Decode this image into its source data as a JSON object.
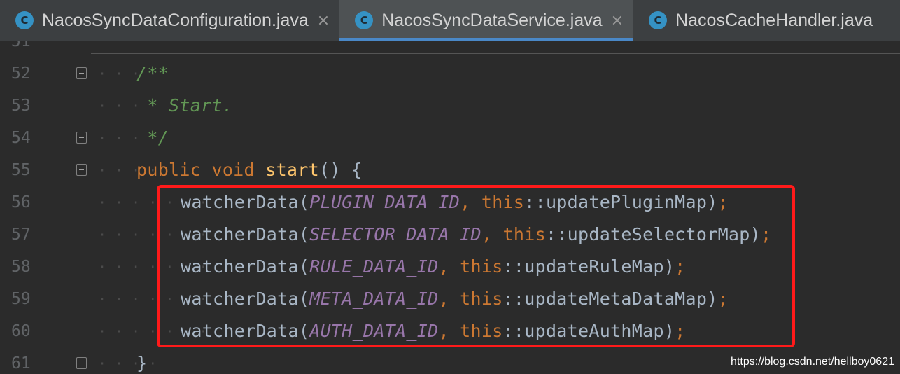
{
  "tabs": [
    {
      "label": "NacosSyncDataConfiguration.java",
      "icon": "C",
      "active": false
    },
    {
      "label": "NacosSyncDataService.java",
      "icon": "C",
      "active": true
    },
    {
      "label": "NacosCacheHandler.java",
      "icon": "C",
      "active": false
    }
  ],
  "close_glyph": "×",
  "partial_line_number": "51",
  "lines": [
    {
      "no": "52",
      "tokens": [
        {
          "t": "/**",
          "c": "comment"
        }
      ]
    },
    {
      "no": "53",
      "tokens": [
        {
          "t": " * Start.",
          "c": "comment"
        }
      ]
    },
    {
      "no": "54",
      "tokens": [
        {
          "t": " */",
          "c": "comment"
        }
      ]
    },
    {
      "no": "55",
      "tokens": [
        {
          "t": "public",
          "c": "kw"
        },
        {
          "t": " ",
          "c": "plain"
        },
        {
          "t": "void",
          "c": "kw"
        },
        {
          "t": " ",
          "c": "plain"
        },
        {
          "t": "start",
          "c": "fn"
        },
        {
          "t": "() {",
          "c": "plain"
        }
      ]
    },
    {
      "no": "56",
      "tokens": [
        {
          "t": "watcherData(",
          "c": "plain"
        },
        {
          "t": "PLUGIN_DATA_ID",
          "c": "const"
        },
        {
          "t": ", ",
          "c": "kw"
        },
        {
          "t": "this",
          "c": "kw"
        },
        {
          "t": "::updatePluginMap)",
          "c": "plain"
        },
        {
          "t": ";",
          "c": "kw"
        }
      ]
    },
    {
      "no": "57",
      "tokens": [
        {
          "t": "watcherData(",
          "c": "plain"
        },
        {
          "t": "SELECTOR_DATA_ID",
          "c": "const"
        },
        {
          "t": ", ",
          "c": "kw"
        },
        {
          "t": "this",
          "c": "kw"
        },
        {
          "t": "::updateSelectorMap)",
          "c": "plain"
        },
        {
          "t": ";",
          "c": "kw"
        }
      ]
    },
    {
      "no": "58",
      "tokens": [
        {
          "t": "watcherData(",
          "c": "plain"
        },
        {
          "t": "RULE_DATA_ID",
          "c": "const"
        },
        {
          "t": ", ",
          "c": "kw"
        },
        {
          "t": "this",
          "c": "kw"
        },
        {
          "t": "::updateRuleMap)",
          "c": "plain"
        },
        {
          "t": ";",
          "c": "kw"
        }
      ]
    },
    {
      "no": "59",
      "tokens": [
        {
          "t": "watcherData(",
          "c": "plain"
        },
        {
          "t": "META_DATA_ID",
          "c": "const"
        },
        {
          "t": ", ",
          "c": "kw"
        },
        {
          "t": "this",
          "c": "kw"
        },
        {
          "t": "::updateMetaDataMap)",
          "c": "plain"
        },
        {
          "t": ";",
          "c": "kw"
        }
      ]
    },
    {
      "no": "60",
      "tokens": [
        {
          "t": "watcherData(",
          "c": "plain"
        },
        {
          "t": "AUTH_DATA_ID",
          "c": "const"
        },
        {
          "t": ", ",
          "c": "kw"
        },
        {
          "t": "this",
          "c": "kw"
        },
        {
          "t": "::updateAuthMap)",
          "c": "plain"
        },
        {
          "t": ";",
          "c": "kw"
        }
      ]
    },
    {
      "no": "61",
      "tokens": [
        {
          "t": "}",
          "c": "plain"
        }
      ]
    }
  ],
  "watermark": "https://blog.csdn.net/hellboy0621",
  "colors": {
    "background": "#2b2b2b",
    "comment": "#629755",
    "keyword": "#cc7832",
    "function": "#ffc66d",
    "constant": "#9876aa",
    "text": "#a9b7c6",
    "highlight_box": "#ff1a1a",
    "active_tab_underline": "#4a88c7"
  }
}
